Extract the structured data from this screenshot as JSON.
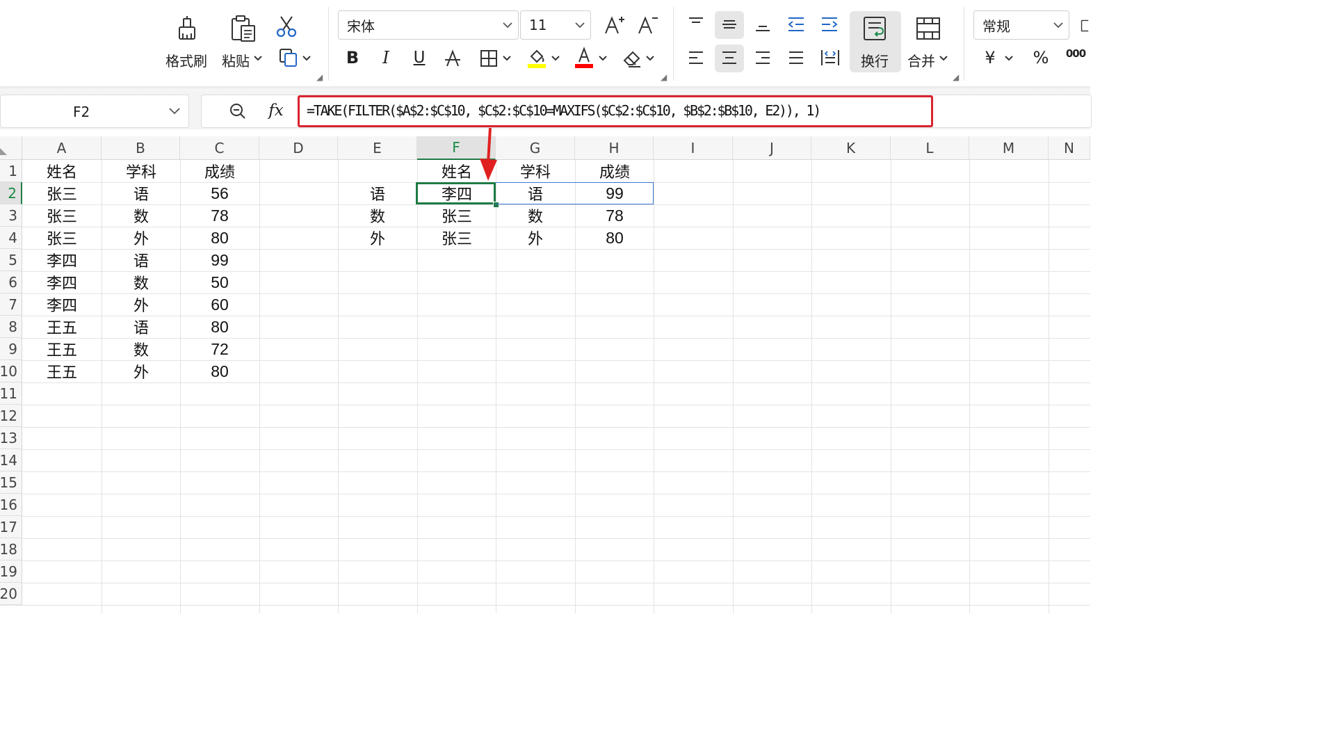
{
  "ribbon": {
    "format_painter_label": "格式刷",
    "paste_label": "粘贴",
    "font_name": "宋体",
    "font_size": "11",
    "wrap_label": "换行",
    "merge_label": "合并",
    "number_format": "常规",
    "currency_symbol": "¥",
    "percent_symbol": "%",
    "thousands_symbol": "000",
    "bold_glyph": "B",
    "italic_glyph": "I",
    "underline_glyph": "U",
    "fill_color": "#ffff00",
    "font_color": "#ff0000"
  },
  "formula_bar": {
    "cell_ref": "F2",
    "fx_label": "fx",
    "formula": "=TAKE(FILTER($A$2:$C$10, $C$2:$C$10=MAXIFS($C$2:$C$10, $B$2:$B$10, E2)), 1)"
  },
  "sheet": {
    "columns": [
      "A",
      "B",
      "C",
      "D",
      "E",
      "F",
      "G",
      "H",
      "I",
      "J",
      "K",
      "L",
      "M",
      "N"
    ],
    "rows": [
      "1",
      "2",
      "3",
      "4",
      "5",
      "6",
      "7",
      "8",
      "9",
      "10",
      "11",
      "12",
      "13",
      "14",
      "15",
      "16",
      "17",
      "18",
      "19",
      "20"
    ],
    "selected_cell": "F2",
    "cells": {
      "A1": "姓名",
      "B1": "学科",
      "C1": "成绩",
      "A2": "张三",
      "B2": "语",
      "C2": "56",
      "A3": "张三",
      "B3": "数",
      "C3": "78",
      "A4": "张三",
      "B4": "外",
      "C4": "80",
      "A5": "李四",
      "B5": "语",
      "C5": "99",
      "A6": "李四",
      "B6": "数",
      "C6": "50",
      "A7": "李四",
      "B7": "外",
      "C7": "60",
      "A8": "王五",
      "B8": "语",
      "C8": "80",
      "A9": "王五",
      "B9": "数",
      "C9": "72",
      "A10": "王五",
      "B10": "外",
      "C10": "80",
      "F1": "姓名",
      "G1": "学科",
      "H1": "成绩",
      "E2": "语",
      "F2": "李四",
      "G2": "语",
      "H2": "99",
      "E3": "数",
      "F3": "张三",
      "G3": "数",
      "H3": "78",
      "E4": "外",
      "F4": "张三",
      "G4": "外",
      "H4": "80"
    },
    "numeric_columns": [
      "C",
      "H"
    ]
  },
  "colors": {
    "selection_green": "#1e7b45",
    "annotation_red": "#d9232e",
    "spill_blue": "#3c78d8"
  }
}
